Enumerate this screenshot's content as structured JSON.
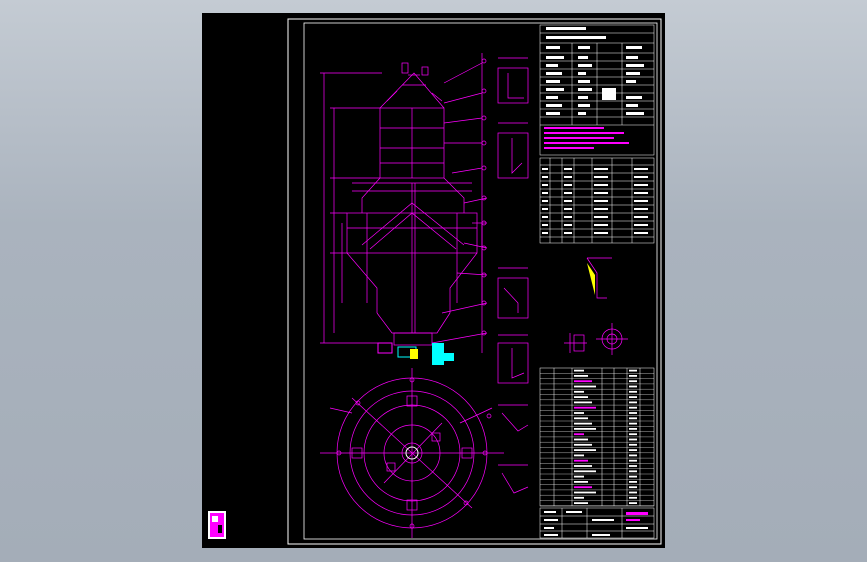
{
  "app": {
    "background_color": "#a9b2bd",
    "viewport_color": "#000000"
  },
  "drawing": {
    "frame_color": "#ffffff",
    "line_color": "#ff00ff",
    "table_line_color": "#ffffff",
    "accent_color": "#00ffff",
    "marker_color": "#ffff00"
  }
}
